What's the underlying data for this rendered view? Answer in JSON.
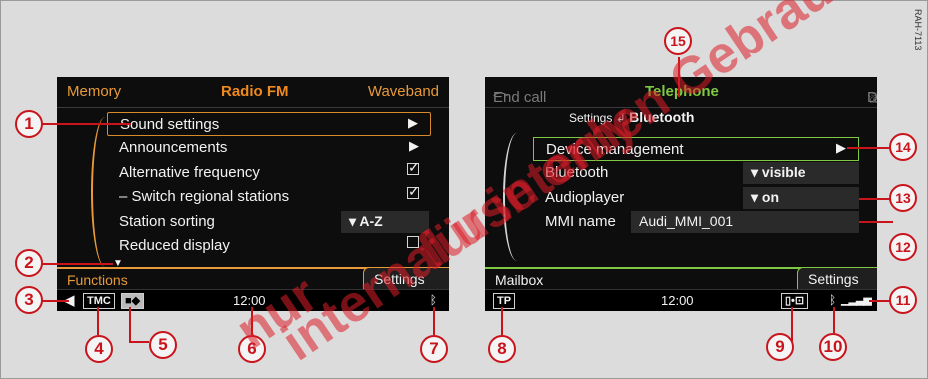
{
  "left_screen": {
    "top_tabs": [
      "Memory",
      "Radio FM",
      "Waveband"
    ],
    "menu": [
      {
        "label": "Sound settings",
        "control": "arrow",
        "selected": true
      },
      {
        "label": "Announcements",
        "control": "arrow"
      },
      {
        "label": "Alternative frequency",
        "control": "checked"
      },
      {
        "label": "– Switch regional stations",
        "control": "checked"
      },
      {
        "label": "Station sorting",
        "control": "value",
        "value": "▾ A-Z"
      },
      {
        "label": "Reduced display",
        "control": "unchecked"
      }
    ],
    "bottom_left": "Functions",
    "bottom_right": "Settings",
    "status": {
      "tmc": "TMC",
      "time": "12:00"
    }
  },
  "right_screen": {
    "top_left": "End call",
    "top_center": "Telephone",
    "top_right": "Dial",
    "breadcrumb_parent": "Settings",
    "breadcrumb_current": "Bluetooth",
    "rows": [
      {
        "label": "Device management",
        "control": "arrow"
      },
      {
        "label": "Bluetooth",
        "value": "▾ visible"
      },
      {
        "label": "Audioplayer",
        "value": "▾ on"
      },
      {
        "label": "MMI name",
        "value": "Audi_MMI_001"
      }
    ],
    "bottom_left": "Mailbox",
    "bottom_right": "Settings",
    "status": {
      "tp": "TP",
      "time": "12:00"
    }
  },
  "callouts": [
    "1",
    "2",
    "3",
    "4",
    "5",
    "6",
    "7",
    "8",
    "9",
    "10",
    "11",
    "12",
    "13",
    "14",
    "15"
  ],
  "watermark": [
    "für internen Gebrauch",
    "nur",
    "internal use only"
  ],
  "side_code": "RAH-7113",
  "colors": {
    "accent_orange": "#f08a1c",
    "accent_green": "#7fc843",
    "callout_red": "#c9141c"
  }
}
